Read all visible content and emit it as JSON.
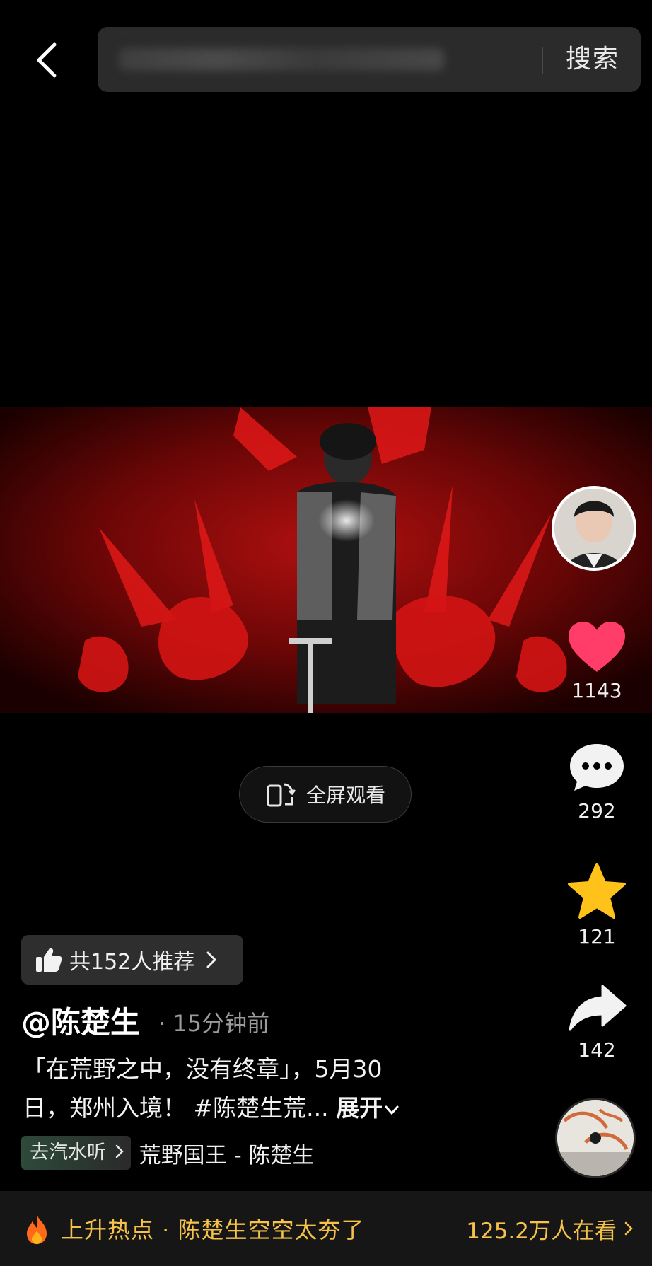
{
  "header": {
    "search_button": "搜索"
  },
  "video": {
    "fullscreen_label": "全屏观看"
  },
  "actions": {
    "likes": "1143",
    "comments": "292",
    "favorites": "121",
    "shares": "142"
  },
  "post": {
    "recommend_label": "共152人推荐",
    "author": "@陈楚生",
    "time": "· 15分钟前",
    "desc_line1": "「在荒野之中，没有终章」，5月30",
    "desc_line2": "日，郑州入境！ #陈楚生荒...",
    "expand_label": "展开",
    "music_tag": "去汽水听",
    "music_name": "荒野国王 - 陈楚生"
  },
  "hotbar": {
    "label": "上升热点 · 陈楚生空空太夯了",
    "viewers": "125.2万人在看"
  },
  "colors": {
    "accent_gold": "#f6c24a",
    "like_red": "#ff3d68",
    "star_yellow": "#ffc21a"
  }
}
